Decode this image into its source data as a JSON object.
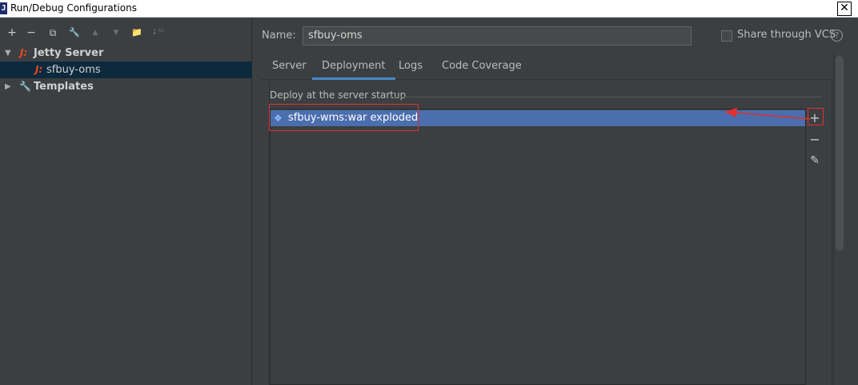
{
  "window": {
    "app_icon_letter": "J",
    "title": "Run/Debug Configurations",
    "close_glyph": "✕"
  },
  "toolbar": {
    "add": "+",
    "remove": "−",
    "copy": "⧉",
    "edit_defaults": "🔧",
    "move_up": "▲",
    "move_down": "▼",
    "new_folder": "📁",
    "sort": "↓ᴬᶻ"
  },
  "tree": {
    "group_label": "Jetty Server",
    "selected_config": "sfbuy-oms",
    "templates_label": "Templates",
    "jetty_icon_glyph": "J:",
    "wrench_icon_glyph": "🔧"
  },
  "config": {
    "name_label": "Name:",
    "name_value": "sfbuy-oms",
    "share_label": "Share through VCS",
    "share_checked": false,
    "help_glyph": "?"
  },
  "tabs": [
    {
      "label": "Server",
      "active": false
    },
    {
      "label": "Deployment",
      "active": true
    },
    {
      "label": "Logs",
      "active": false
    },
    {
      "label": "Code Coverage",
      "active": false
    }
  ],
  "deployment": {
    "section_title": "Deploy at the server startup",
    "items": [
      {
        "label": "sfbuy-wms:war exploded",
        "icon": "artifact-icon"
      }
    ],
    "add_glyph": "+",
    "remove_glyph": "−",
    "edit_glyph": "✎"
  },
  "colors": {
    "background": "#3c3f41",
    "selection": "#4b6eaf",
    "tree_selection": "#0d293e",
    "highlight_annotation": "#e03030",
    "tab_underline": "#4a88c7",
    "jetty_icon": "#e8491d"
  }
}
